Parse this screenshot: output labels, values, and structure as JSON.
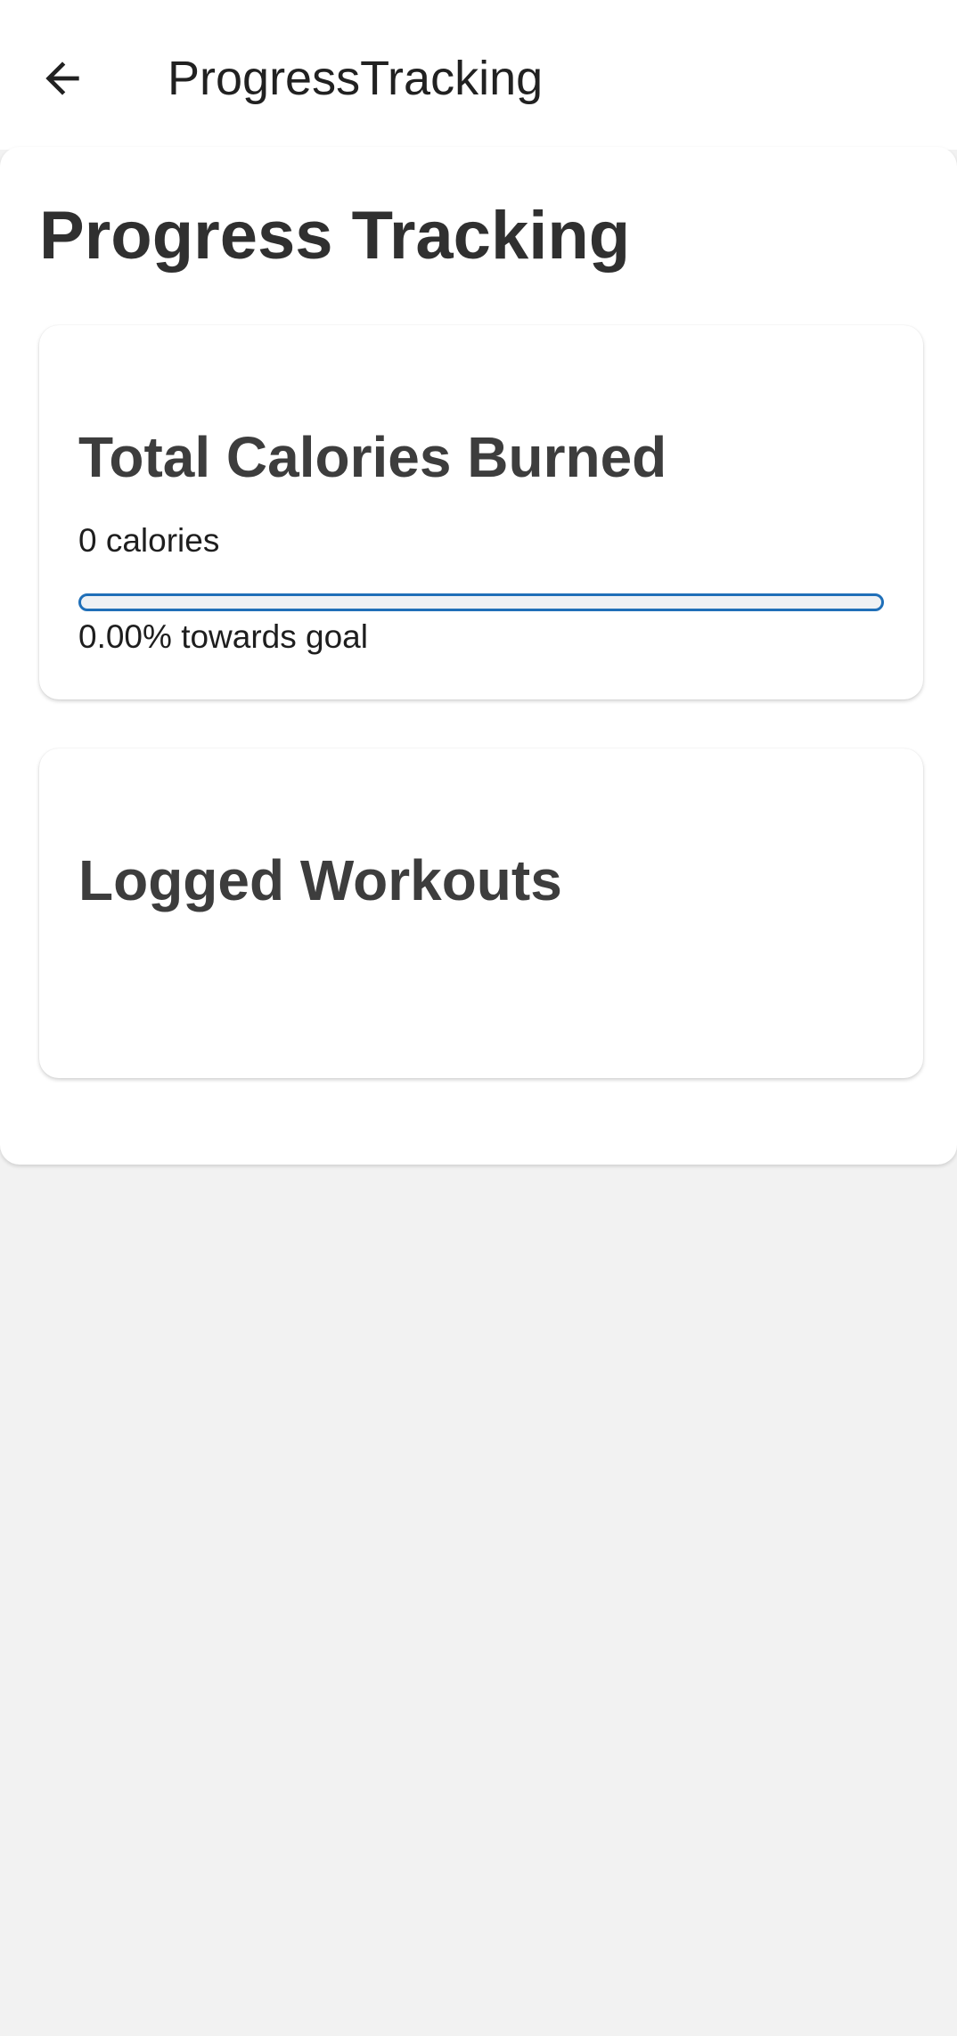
{
  "app_bar": {
    "title": "ProgressTracking",
    "back_icon": "arrow-left-icon"
  },
  "page": {
    "title": "Progress Tracking"
  },
  "calories_card": {
    "heading": "Total Calories Burned",
    "value_text": "0 calories",
    "progress_percent": 0,
    "progress_text": "0.00% towards goal"
  },
  "workouts_card": {
    "heading": "Logged Workouts"
  },
  "colors": {
    "accent": "#1f6fb8",
    "background": "#f2f2f2",
    "surface": "#ffffff"
  }
}
